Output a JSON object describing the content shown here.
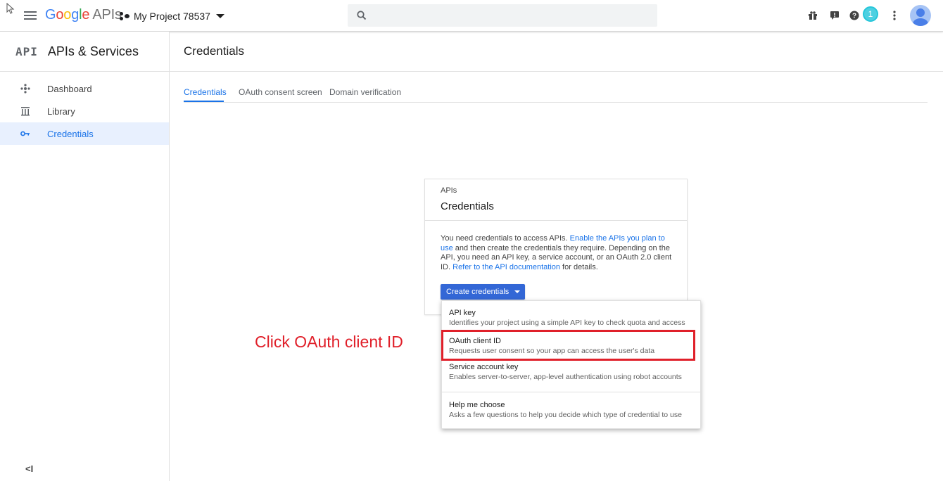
{
  "header": {
    "brand_google": "Google",
    "brand_apis": "APIs",
    "project_name": "My Project 78537",
    "search_placeholder": "",
    "notifications_count": "1",
    "icons": [
      "menu-icon",
      "search-icon",
      "gift-icon",
      "feedback-icon",
      "help-icon",
      "notifications-icon",
      "more-vert-icon",
      "account-avatar-icon"
    ]
  },
  "sidebar": {
    "logo": "API",
    "title": "APIs & Services",
    "items": [
      {
        "label": "Dashboard",
        "icon": "dashboard-icon"
      },
      {
        "label": "Library",
        "icon": "library-icon"
      },
      {
        "label": "Credentials",
        "icon": "key-icon",
        "active": true
      }
    ],
    "collapse_label": "<I"
  },
  "main": {
    "title": "Credentials",
    "tabs": [
      {
        "label": "Credentials",
        "active": true
      },
      {
        "label": "OAuth consent screen"
      },
      {
        "label": "Domain verification"
      }
    ]
  },
  "card": {
    "eyebrow": "APIs",
    "title": "Credentials",
    "body_1": "You need credentials to access APIs. ",
    "link_1": "Enable the APIs you plan to use",
    "body_2": " and then create the credentials they require. Depending on the API, you need an API key, a service account, or an OAuth 2.0 client ID. ",
    "link_2": "Refer to the API documentation",
    "body_3": " for details.",
    "create_button": "Create credentials"
  },
  "menu": {
    "items": [
      {
        "title": "API key",
        "desc": "Identifies your project using a simple API key to check quota and access"
      },
      {
        "title": "OAuth client ID",
        "desc": "Requests user consent so your app can access the user's data"
      },
      {
        "title": "Service account key",
        "desc": "Enables server-to-server, app-level authentication using robot accounts"
      },
      {
        "title": "Help me choose",
        "desc": "Asks a few questions to help you decide which type of credential to use"
      }
    ]
  },
  "annotation": {
    "text": "Click OAuth client ID",
    "color": "#e0202a"
  },
  "colors": {
    "accent": "#1a73e8",
    "button": "#3367d6",
    "active_nav_bg": "#e8f0fe"
  }
}
